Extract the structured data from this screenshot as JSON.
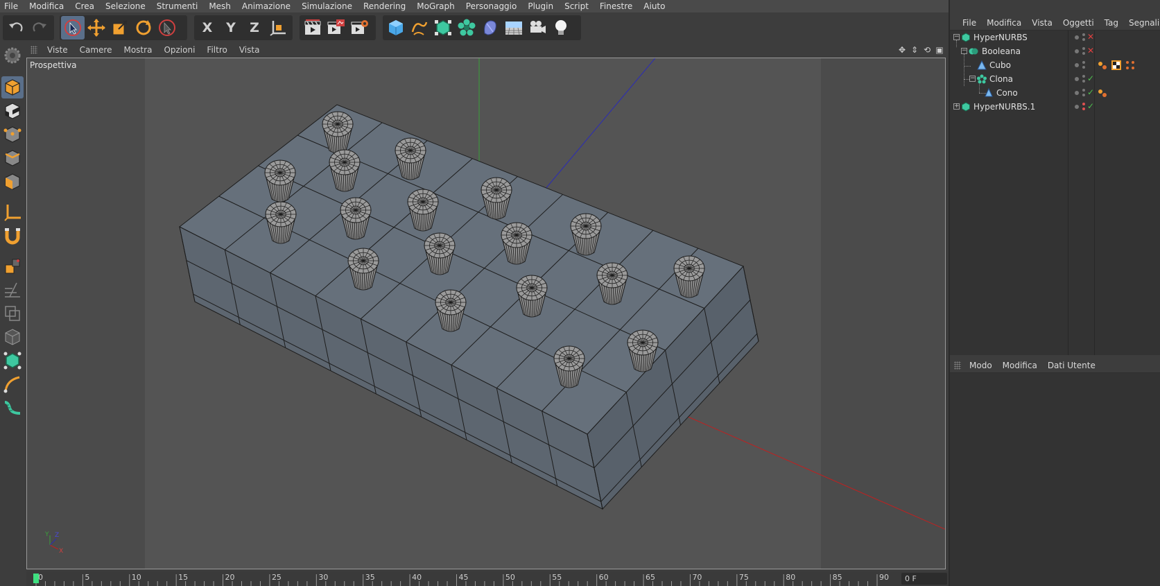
{
  "main_menu": [
    "File",
    "Modifica",
    "Crea",
    "Selezione",
    "Strumenti",
    "Mesh",
    "Animazione",
    "Simulazione",
    "Rendering",
    "MoGraph",
    "Personaggio",
    "Plugin",
    "Script",
    "Finestre",
    "Aiuto"
  ],
  "toolbar": {
    "axis_x": "X",
    "axis_y": "Y",
    "axis_z": "Z"
  },
  "viewport": {
    "menu": [
      "Viste",
      "Camere",
      "Mostra",
      "Opzioni",
      "Filtro",
      "Vista"
    ],
    "title": "Prospettiva",
    "axis_labels": {
      "x": "X",
      "y": "Y",
      "z": "Z"
    }
  },
  "timeline": {
    "ticks": [
      "0",
      "5",
      "10",
      "15",
      "20",
      "25",
      "30",
      "35",
      "40",
      "45",
      "50",
      "55",
      "60",
      "65",
      "70",
      "75",
      "80",
      "85",
      "90"
    ],
    "current_frame": "0 F"
  },
  "object_manager": {
    "menu": [
      "File",
      "Modifica",
      "Vista",
      "Oggetti",
      "Tag",
      "Segnalibri"
    ],
    "objects": [
      {
        "name": "HyperNURBS",
        "state": "✕",
        "state_color": "#e04040"
      },
      {
        "name": "Booleana",
        "state": "✕",
        "state_color": "#e04040"
      },
      {
        "name": "Cubo",
        "state": "",
        "state_color": ""
      },
      {
        "name": "Clona",
        "state": "✓",
        "state_color": "#4ec04e"
      },
      {
        "name": "Cono",
        "state": "✓",
        "state_color": "#4ec04e"
      },
      {
        "name": "HyperNURBS.1",
        "state": "✓",
        "state_color": "#4ec04e"
      }
    ]
  },
  "attribute_manager": {
    "menu": [
      "Modo",
      "Modifica",
      "Dati Utente"
    ]
  },
  "colors": {
    "accent_orange": "#f0a030",
    "active_blue": "#5a6f8a",
    "mograph_green": "#3ec8a0"
  }
}
